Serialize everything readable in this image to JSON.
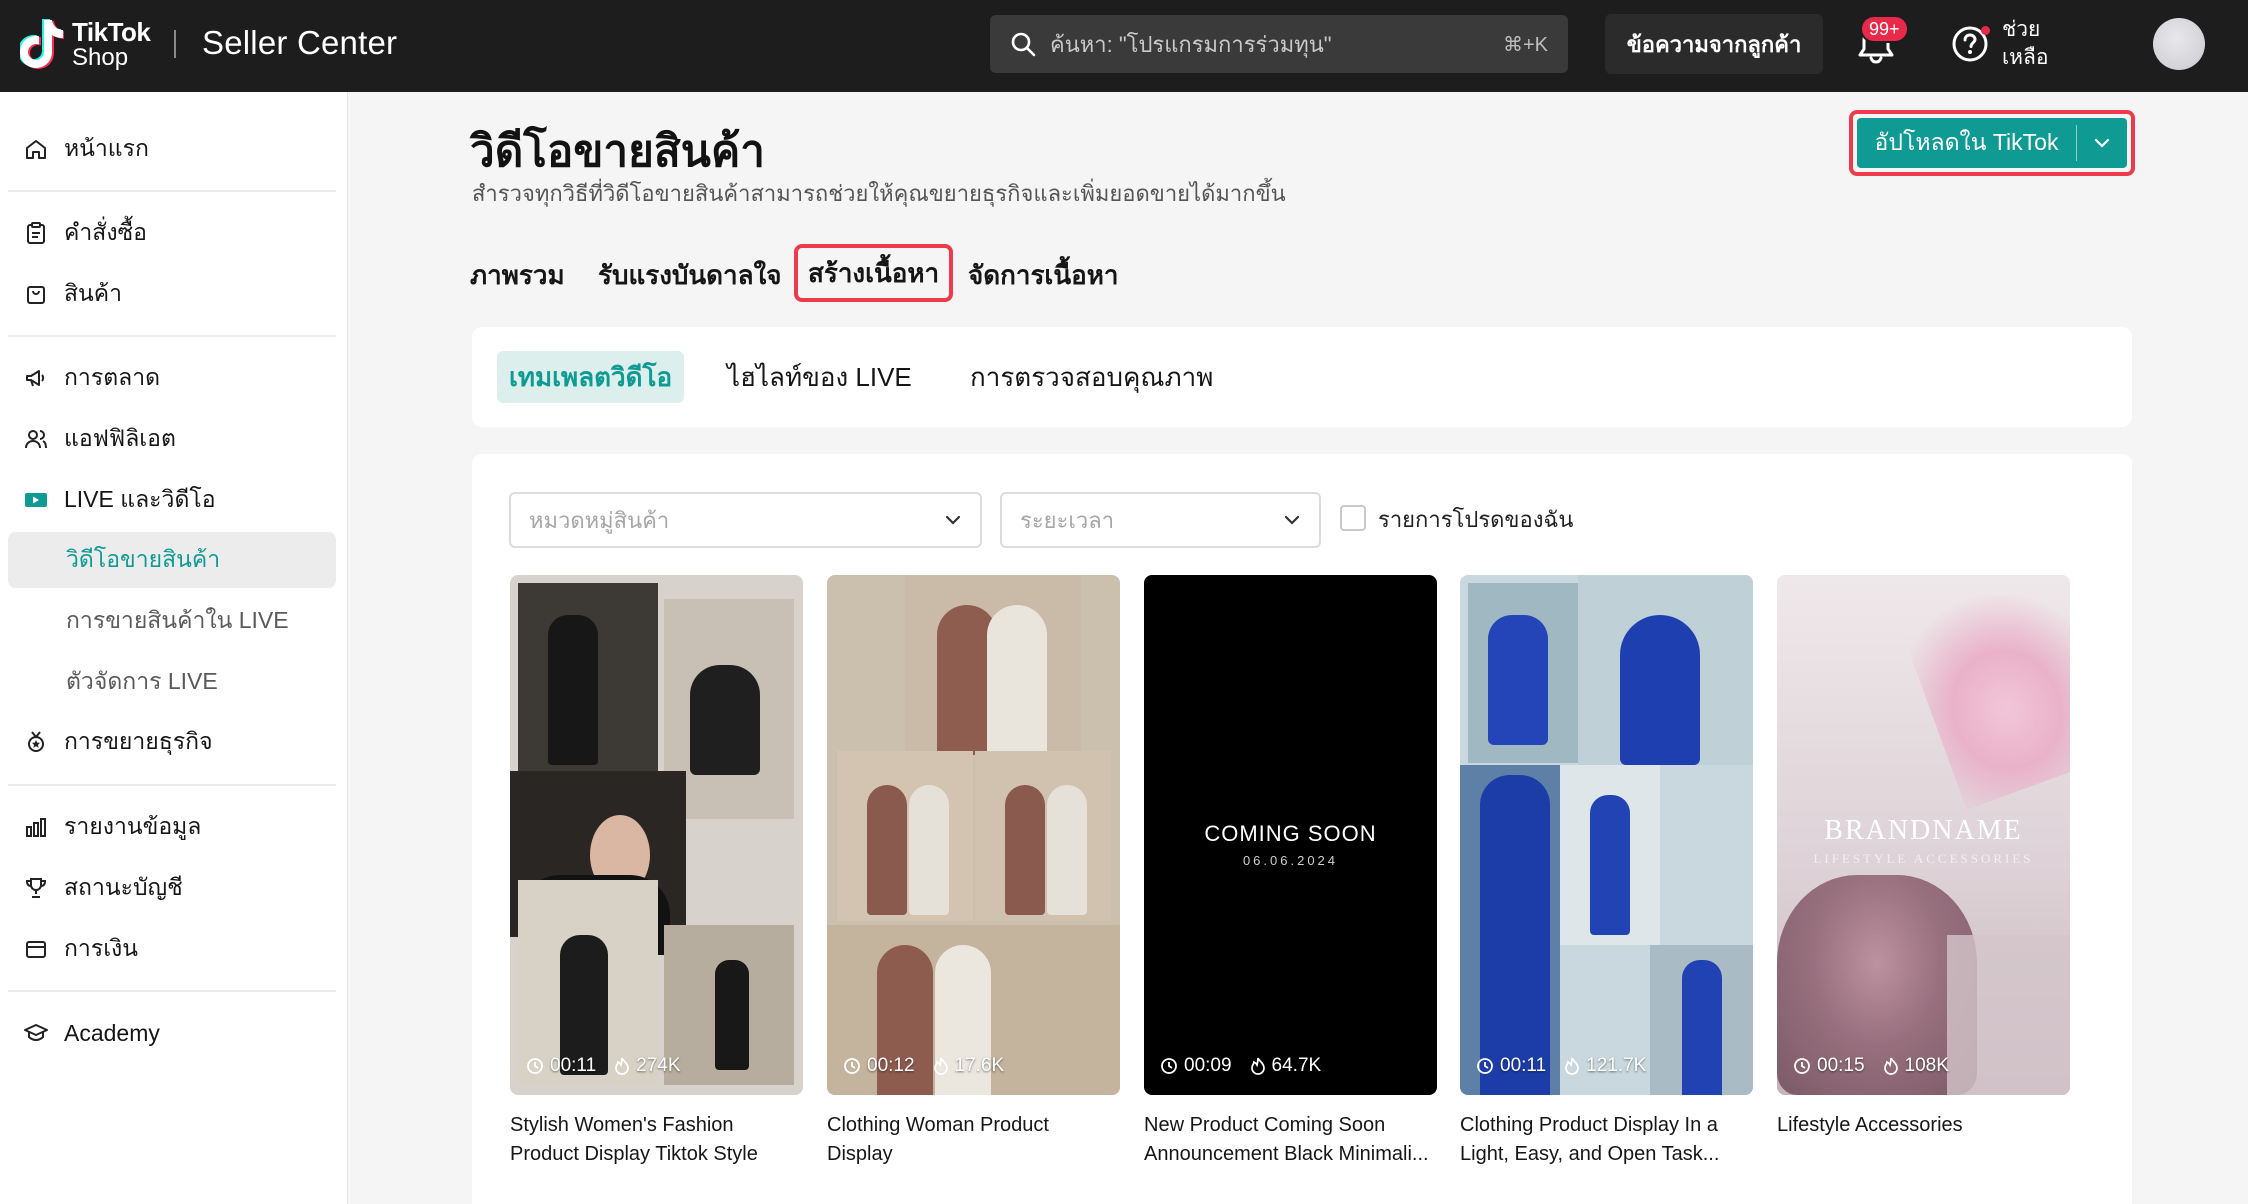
{
  "header": {
    "logo_line1": "TikTok",
    "logo_line2": "Shop",
    "title": "Seller Center",
    "search_placeholder": "ค้นหา: \"โปรแกรมการร่วมทุน\"",
    "search_shortcut": "⌘+K",
    "messages_label": "ข้อความจากลูกค้า",
    "notif_badge": "99+",
    "help_label": "ช่วยเหลือ"
  },
  "sidebar": {
    "items": [
      {
        "label": "หน้าแรก",
        "icon": "home-icon"
      },
      {
        "label": "คำสั่งซื้อ",
        "icon": "clipboard-icon"
      },
      {
        "label": "สินค้า",
        "icon": "bag-icon"
      },
      {
        "label": "การตลาด",
        "icon": "megaphone-icon"
      },
      {
        "label": "แอฟฟิลิเอต",
        "icon": "users-icon"
      },
      {
        "label": "LIVE และวิดีโอ",
        "icon": "video-icon"
      },
      {
        "label": "วิดีโอขายสินค้า",
        "icon": "",
        "active": true
      },
      {
        "label": "การขายสินค้าใน LIVE",
        "icon": ""
      },
      {
        "label": "ตัวจัดการ LIVE",
        "icon": ""
      },
      {
        "label": "การขยายธุรกิจ",
        "icon": "rocket-icon"
      },
      {
        "label": "รายงานข้อมูล",
        "icon": "chart-icon"
      },
      {
        "label": "สถานะบัญชี",
        "icon": "trophy-icon"
      },
      {
        "label": "การเงิน",
        "icon": "wallet-icon"
      },
      {
        "label": "Academy",
        "icon": "graduation-cap-icon"
      }
    ]
  },
  "page": {
    "title": "วิดีโอขายสินค้า",
    "subtitle": "สำรวจทุกวิธีที่วิดีโอขายสินค้าสามารถช่วยให้คุณขยายธุรกิจและเพิ่มยอดขายได้มากขึ้น",
    "upload_label": "อัปโหลดใน TikTok"
  },
  "tabs": [
    "ภาพรวม",
    "รับแรงบันดาลใจ",
    "สร้างเนื้อหา",
    "จัดการเนื้อหา"
  ],
  "active_tab": "สร้างเนื้อหา",
  "subtabs": [
    "เทมเพลตวิดีโอ",
    "ไฮไลท์ของ LIVE",
    "การตรวจสอบคุณภาพ"
  ],
  "filters": {
    "category_placeholder": "หมวดหมู่สินค้า",
    "duration_placeholder": "ระยะเวลา",
    "favorites_label": "รายการโปรดของฉัน"
  },
  "templates": [
    {
      "duration": "00:11",
      "uses": "274K",
      "title": "Stylish Women's Fashion Product Display Tiktok Style"
    },
    {
      "duration": "00:12",
      "uses": "17.6K",
      "title": "Clothing Woman Product Display"
    },
    {
      "duration": "00:09",
      "uses": "64.7K",
      "title": "New Product Coming Soon Announcement Black Minimali...",
      "overlay_title": "COMING SOON",
      "overlay_sub": "06.06.2024"
    },
    {
      "duration": "00:11",
      "uses": "121.7K",
      "title": "Clothing Product Display In a Light, Easy, and Open Task..."
    },
    {
      "duration": "00:15",
      "uses": "108K",
      "title": "Lifestyle Accessories",
      "overlay_title": "BRANDNAME",
      "overlay_sub": "LIFESTYLE ACCESSORIES"
    }
  ],
  "colors": {
    "accent": "#0f9a94",
    "highlight_border": "#ee3b4b",
    "topbar": "#1d1d1d",
    "badge": "#e8294a"
  }
}
